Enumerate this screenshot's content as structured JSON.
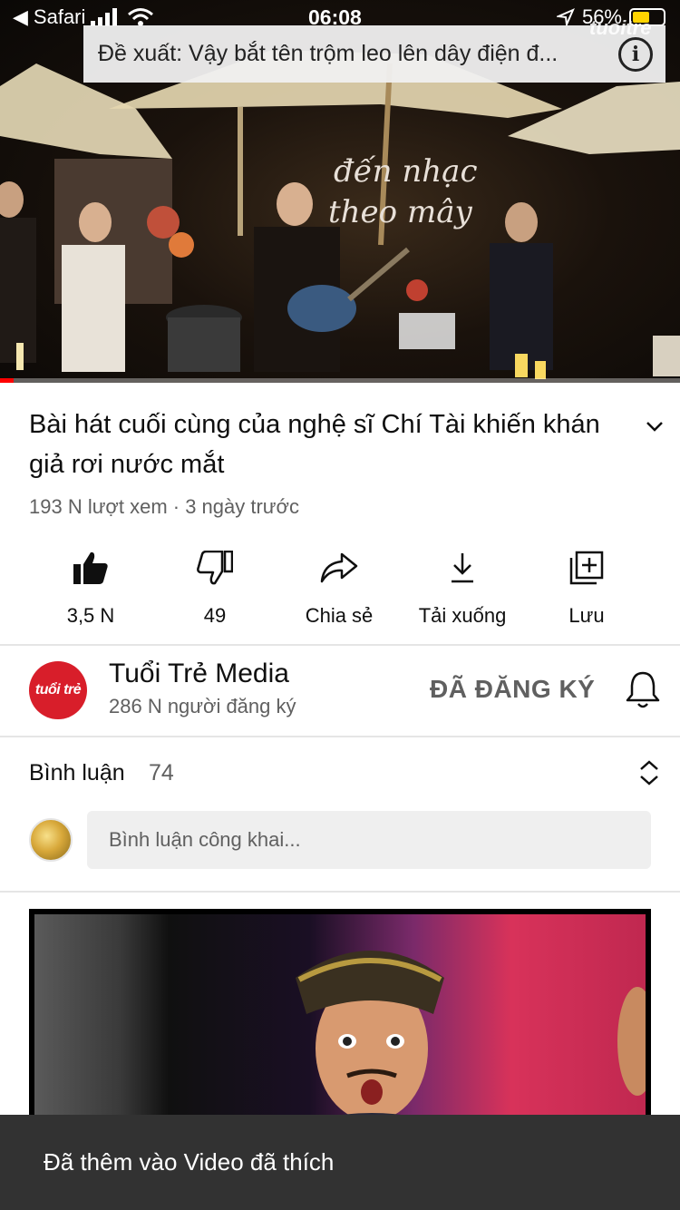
{
  "status_bar": {
    "back_app": "Safari",
    "time": "06:08",
    "battery": "56%"
  },
  "player": {
    "suggestion_text": "Đề xuất: Vậy bắt tên trộm leo lên dây điện đ...",
    "watermark": "tuoitre",
    "progress": 0.02
  },
  "video": {
    "title": "Bài hát cuối cùng của nghệ sĩ Chí Tài khiến khán giả rơi nước mắt",
    "meta": "193 N lượt xem · 3 ngày trước"
  },
  "actions": [
    {
      "name": "like",
      "label": "3,5 N"
    },
    {
      "name": "dislike",
      "label": "49"
    },
    {
      "name": "share",
      "label": "Chia sẻ"
    },
    {
      "name": "download",
      "label": "Tải xuống"
    },
    {
      "name": "save",
      "label": "Lưu"
    }
  ],
  "channel": {
    "avatar_text": "tuổi trẻ",
    "name": "Tuổi Trẻ Media",
    "subscribers": "286 N người đăng ký",
    "subscribe_state": "ĐÃ ĐĂNG KÝ"
  },
  "comments": {
    "title": "Bình luận",
    "count": "74",
    "placeholder": "Bình luận công khai..."
  },
  "toast": {
    "message": "Đã thêm vào Video đã thích"
  },
  "colors": {
    "progress_red": "#ff0000",
    "toast_bg": "#323232",
    "channel_brand": "#d81e2a",
    "battery_yellow": "#ffd400"
  },
  "icons": {
    "like": "thumbs-up-filled-icon",
    "dislike": "thumbs-down-outline-icon",
    "share": "share-arrow-icon",
    "download": "download-icon",
    "save": "playlist-add-icon",
    "expand": "chevron-down-icon",
    "bell": "bell-icon",
    "sort": "sort-updown-icon",
    "info": "info-icon"
  }
}
